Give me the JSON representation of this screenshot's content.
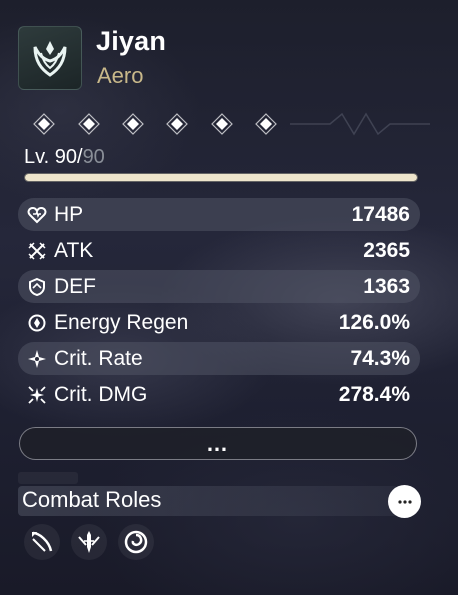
{
  "character": {
    "name": "Jiyan",
    "element": "Aero",
    "emblem_icon": "aero-element-icon",
    "element_color": "#c8b88a"
  },
  "sequence_nodes": {
    "count": 6,
    "icon": "diamond-icon"
  },
  "level": {
    "prefix": "Lv. 90/",
    "current": 90,
    "max_label": "90",
    "progress": 1.0
  },
  "stats": [
    {
      "label": "HP",
      "value": "17486",
      "icon": "hp-icon"
    },
    {
      "label": "ATK",
      "value": "2365",
      "icon": "atk-icon"
    },
    {
      "label": "DEF",
      "value": "1363",
      "icon": "def-icon"
    },
    {
      "label": "Energy Regen",
      "value": "126.0%",
      "icon": "energy-regen-icon"
    },
    {
      "label": "Crit. Rate",
      "value": "74.3%",
      "icon": "crit-rate-icon"
    },
    {
      "label": "Crit. DMG",
      "value": "278.4%",
      "icon": "crit-dmg-icon"
    }
  ],
  "more_button": {
    "label": "…",
    "icon": "more-dots-icon"
  },
  "combat_roles": {
    "title": "Combat Roles",
    "info_icon": "more-dots-icon",
    "roles": [
      {
        "icon": "role-slash-icon"
      },
      {
        "icon": "role-blade-icon"
      },
      {
        "icon": "role-swirl-icon"
      }
    ]
  }
}
